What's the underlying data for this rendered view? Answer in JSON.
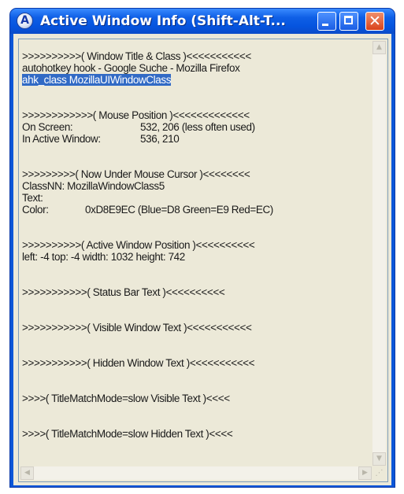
{
  "window": {
    "icon_letter": "A",
    "title": "Active Window Info (Shift-Alt-T...",
    "close_glyph": "✕"
  },
  "info": {
    "window_title_header": ">>>>>>>>>>( Window Title & Class )<<<<<<<<<<<",
    "window_title": "autohotkey hook - Google Suche - Mozilla Firefox",
    "window_class": "ahk_class MozillaUIWindowClass",
    "mouse_header": ">>>>>>>>>>>>( Mouse Position )<<<<<<<<<<<<<",
    "on_screen_label": "On Screen:",
    "on_screen_value": "532, 206  (less often used)",
    "in_active_label": "In Active Window:",
    "in_active_value": "536, 210",
    "under_cursor_header": ">>>>>>>>>( Now Under Mouse Cursor )<<<<<<<<",
    "classnn": "ClassNN:  MozillaWindowClass5",
    "text_line": "Text:",
    "color_label": "Color:",
    "color_value": "0xD8E9EC  (Blue=D8 Green=E9 Red=EC)",
    "position_header": ">>>>>>>>>>( Active Window Position )<<<<<<<<<<",
    "position_values": "left: -4     top: -4     width: 1032     height: 742",
    "status_header": ">>>>>>>>>>>( Status Bar Text )<<<<<<<<<<",
    "visible_header": ">>>>>>>>>>>( Visible Window Text )<<<<<<<<<<<",
    "hidden_header": ">>>>>>>>>>>( Hidden Window Text )<<<<<<<<<<<",
    "tmm_visible_header": ">>>>( TitleMatchMode=slow Visible Text )<<<<",
    "tmm_hidden_header": ">>>>( TitleMatchMode=slow Hidden Text )<<<<"
  },
  "scrollbars": {
    "up_arrow": "▲",
    "down_arrow": "▼",
    "left_arrow": "◀",
    "right_arrow": "▶",
    "grip": "⋰"
  }
}
